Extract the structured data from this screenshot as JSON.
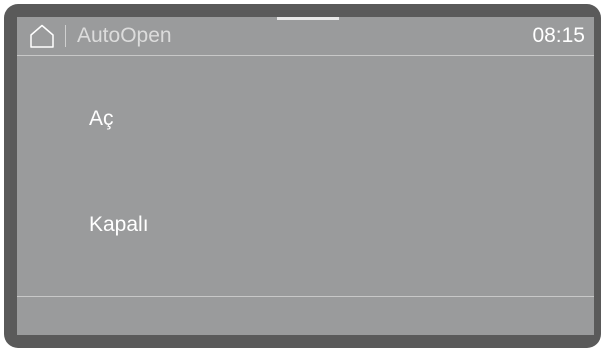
{
  "header": {
    "title": "AutoOpen",
    "time": "08:15",
    "home_icon": "home-icon"
  },
  "options": [
    {
      "label": "Aç"
    },
    {
      "label": "Kapalı"
    }
  ],
  "colors": {
    "bezel": "#5a5a5a",
    "screen": "#9a9b9c",
    "text": "#ffffff",
    "title_text": "#dcdcdc"
  }
}
